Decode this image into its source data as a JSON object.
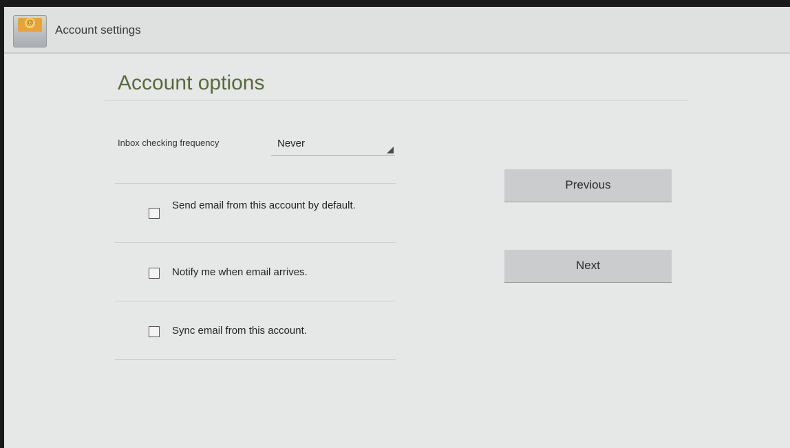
{
  "actionbar": {
    "title": "Account settings",
    "icon": "email-app-icon"
  },
  "main": {
    "heading": "Account options",
    "frequency": {
      "label": "Inbox checking frequency",
      "value": "Never"
    },
    "options": [
      {
        "label": "Send email from this account by default.",
        "checked": false
      },
      {
        "label": "Notify me when email arrives.",
        "checked": false
      },
      {
        "label": "Sync email from this account.",
        "checked": false
      }
    ]
  },
  "buttons": {
    "previous": "Previous",
    "next": "Next"
  },
  "colors": {
    "accent": "#5a6a3c",
    "background": "#e6e7e7",
    "button": "#cbcccd"
  }
}
